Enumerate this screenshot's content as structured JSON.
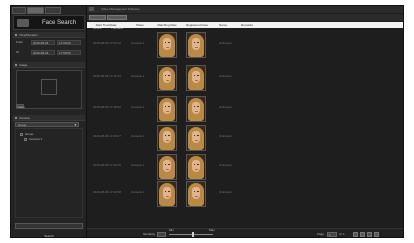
{
  "left_panel": {
    "tabs": [
      "Live",
      "Search",
      "Setup"
    ],
    "title": "Face Search",
    "sections": {
      "time": "Time/Duration",
      "image": "Image",
      "camera": "Camera"
    },
    "time_fields": {
      "from_label": "From",
      "to_label": "To",
      "from_date": "2016-08-26",
      "from_time": "17:00:00",
      "to_date": "2016-08-26",
      "to_time": "17:59:59"
    },
    "image_button": "Open",
    "camera_dropdown": "Group",
    "camera_tree": [
      "Group",
      "Camera 1"
    ],
    "search_button": "Search"
  },
  "right_panel": {
    "app_title": "Video Management Software",
    "subtabs": [
      "Result",
      "Playback"
    ],
    "columns": [
      "Start Time/Date",
      "Place",
      "Matching Rate",
      "Registered Face",
      "Name",
      "Remarks"
    ],
    "rows": [
      {
        "time": "2016-08-26 17:04:12",
        "place": "Camera 1",
        "rate": "95%",
        "name": "Unknown"
      },
      {
        "time": "2016-08-26 17:11:34",
        "place": "Camera 1",
        "rate": "93%",
        "name": "Unknown"
      },
      {
        "time": "2016-08-26 17:18:02",
        "place": "Camera 1",
        "rate": "91%",
        "name": "Unknown"
      },
      {
        "time": "2016-08-26 17:26:47",
        "place": "Camera 1",
        "rate": "90%",
        "name": "Unknown"
      },
      {
        "time": "2016-08-26 17:33:15",
        "place": "Camera 1",
        "rate": "88%",
        "name": "Unknown"
      },
      {
        "time": "2016-08-26 17:41:58",
        "place": "Camera 1",
        "rate": "86%",
        "name": "Unknown"
      }
    ],
    "bottom": {
      "left_label": "Similarity",
      "min_label": "Min",
      "max_label": "Max",
      "slider_value": 0.55,
      "page_label": "Page",
      "page_value": "1",
      "of_label": "of",
      "total_pages": "1"
    }
  },
  "colors": {
    "panel_bg": "#1d1d1d",
    "header_bg": "#f2f2f2",
    "accent": "#5a5a5a"
  }
}
